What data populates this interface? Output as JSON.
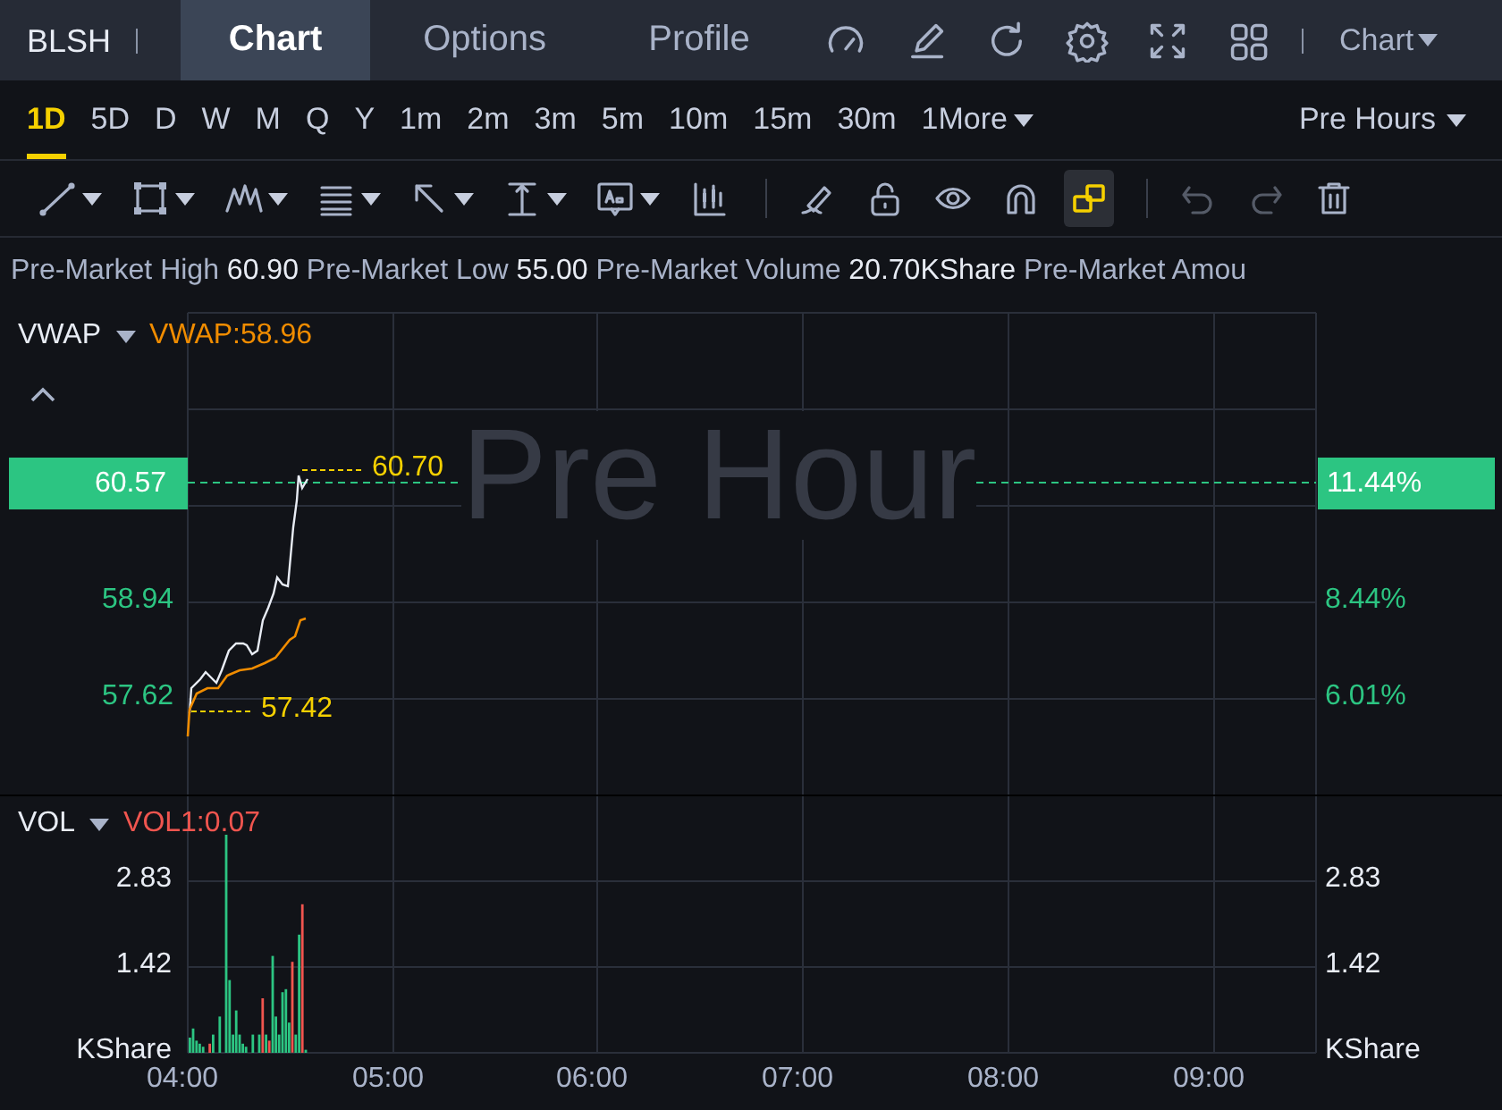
{
  "header": {
    "symbol": "BLSH",
    "tabs": [
      {
        "label": "Chart",
        "selected": true
      },
      {
        "label": "Options",
        "selected": false
      },
      {
        "label": "Profile",
        "selected": false
      }
    ],
    "menu": "Chart"
  },
  "periods": [
    {
      "label": "1D",
      "selected": true
    },
    {
      "label": "5D",
      "selected": false
    },
    {
      "label": "D",
      "selected": false
    },
    {
      "label": "W",
      "selected": false
    },
    {
      "label": "M",
      "selected": false
    },
    {
      "label": "Q",
      "selected": false
    },
    {
      "label": "Y",
      "selected": false
    },
    {
      "label": "1m",
      "selected": false
    },
    {
      "label": "2m",
      "selected": false
    },
    {
      "label": "3m",
      "selected": false
    },
    {
      "label": "5m",
      "selected": false
    },
    {
      "label": "10m",
      "selected": false
    },
    {
      "label": "15m",
      "selected": false
    },
    {
      "label": "30m",
      "selected": false
    },
    {
      "label": "1",
      "selected": false
    }
  ],
  "more": "More",
  "session": "Pre Hours",
  "tools": [
    {
      "kind": "line",
      "menu": true,
      "on": false,
      "disabled": false
    },
    {
      "kind": "rect",
      "menu": true,
      "on": false,
      "disabled": false
    },
    {
      "kind": "pattern",
      "menu": true,
      "on": false,
      "disabled": false
    },
    {
      "kind": "fib",
      "menu": true,
      "on": false,
      "disabled": false
    },
    {
      "kind": "arrow",
      "menu": true,
      "on": false,
      "disabled": false
    },
    {
      "kind": "measure",
      "menu": true,
      "on": false,
      "disabled": false
    },
    {
      "kind": "text",
      "menu": true,
      "on": false,
      "disabled": false
    },
    {
      "kind": "candles",
      "menu": false,
      "on": false,
      "disabled": false
    },
    {
      "kind": "sep"
    },
    {
      "kind": "pen",
      "menu": false,
      "on": false,
      "disabled": false
    },
    {
      "kind": "lock",
      "menu": false,
      "on": false,
      "disabled": false
    },
    {
      "kind": "eye",
      "menu": false,
      "on": false,
      "disabled": false
    },
    {
      "kind": "magnet",
      "menu": false,
      "on": false,
      "disabled": false
    },
    {
      "kind": "link",
      "menu": false,
      "on": true,
      "disabled": false
    },
    {
      "kind": "sep"
    },
    {
      "kind": "undo",
      "menu": false,
      "on": false,
      "disabled": true
    },
    {
      "kind": "redo",
      "menu": false,
      "on": false,
      "disabled": true
    },
    {
      "kind": "trash",
      "menu": false,
      "on": false,
      "disabled": false
    }
  ],
  "stats": [
    {
      "label": "Pre-Market High",
      "value": "60.90"
    },
    {
      "label": "Pre-Market Low",
      "value": "55.00"
    },
    {
      "label": "Pre-Market Volume",
      "value": "20.70KShare"
    },
    {
      "label": "Pre-Market Amou"
    }
  ],
  "chart": {
    "indicator": "VWAP",
    "reading": "VWAP:58.96",
    "watermark": "Pre Hour",
    "left_axis": [
      "58.94",
      "57.62"
    ],
    "right_axis": [
      "8.44%",
      "6.01%"
    ],
    "last_price": "60.57",
    "last_change": "11.44%",
    "high_marker": "60.70",
    "low_marker": "57.42"
  },
  "volume": {
    "indicator": "VOL",
    "reading": "VOL1:0.07",
    "left_axis": [
      "2.83",
      "1.42"
    ],
    "right_axis": [
      "2.83",
      "1.42"
    ],
    "unit_left": "KShare",
    "unit_right": "KShare"
  },
  "time_axis": [
    "04:00",
    "05:00",
    "06:00",
    "07:00",
    "08:00",
    "09:00"
  ]
}
